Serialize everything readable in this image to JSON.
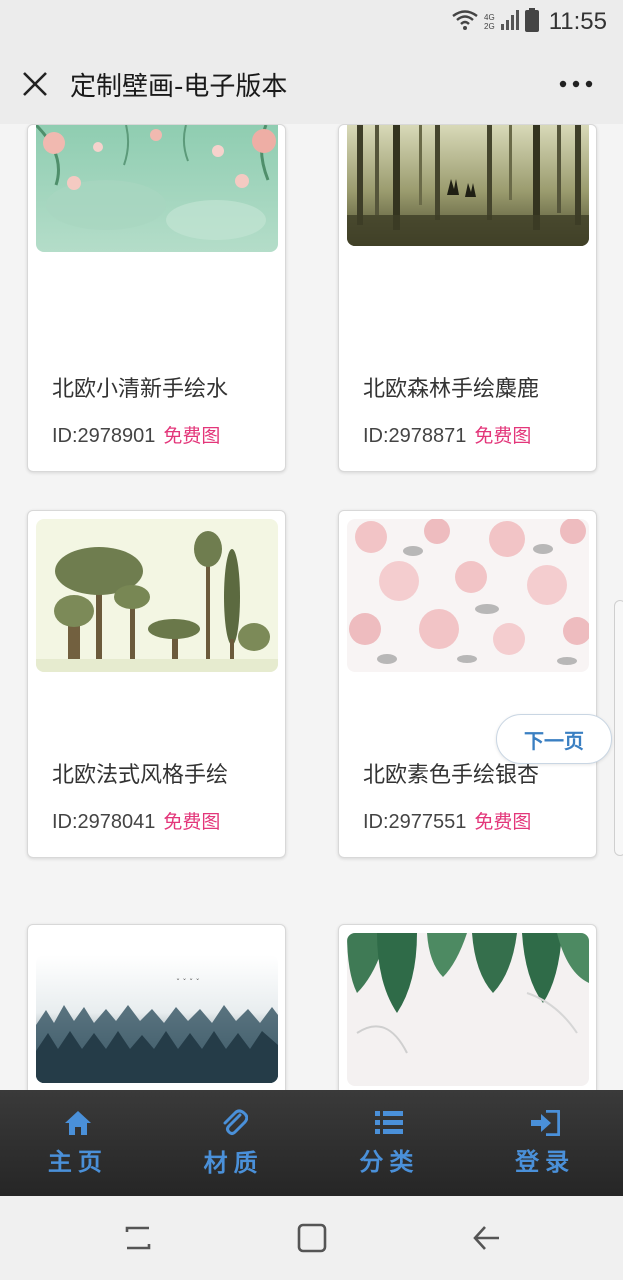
{
  "status_bar": {
    "time": "11:55",
    "network_top": "4G",
    "network_bottom": "2G",
    "icons": [
      "wifi-icon",
      "signal-icon",
      "battery-icon"
    ]
  },
  "header": {
    "title": "定制壁画-电子版本",
    "close_icon": "close-icon",
    "more_icon": "more-icon"
  },
  "products": [
    {
      "title": "北欧小清新手绘水",
      "id": "ID:2978901",
      "tag": "免费图",
      "image": "mint-floral-wallpaper"
    },
    {
      "title": "北欧森林手绘麋鹿",
      "id": "ID:2978871",
      "tag": "免费图",
      "image": "forest-deer-wallpaper"
    },
    {
      "title": "北欧法式风格手绘",
      "id": "ID:2978041",
      "tag": "免费图",
      "image": "hand-drawn-trees-wallpaper"
    },
    {
      "title": "北欧素色手绘银杏",
      "id": "ID:2977551",
      "tag": "免费图",
      "image": "pink-floral-wallpaper"
    },
    {
      "title": "",
      "id": "",
      "tag": "",
      "image": "misty-forest-wallpaper"
    },
    {
      "title": "",
      "id": "",
      "tag": "",
      "image": "tropical-leaves-wallpaper"
    }
  ],
  "next_page_label": "下一页",
  "bottom_nav": [
    {
      "label": "主页",
      "icon": "home-icon"
    },
    {
      "label": "材质",
      "icon": "paperclip-icon"
    },
    {
      "label": "分类",
      "icon": "list-icon"
    },
    {
      "label": "登录",
      "icon": "login-icon"
    }
  ],
  "colors": {
    "accent_blue": "#4a90d9",
    "free_tag_pink": "#e3367a",
    "nav_background": "#2e2e2e"
  }
}
